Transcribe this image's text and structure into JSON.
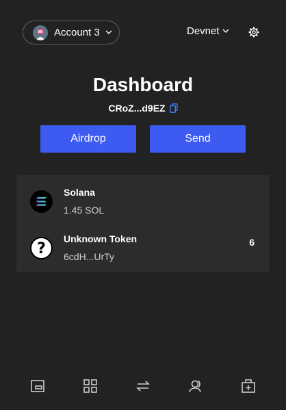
{
  "header": {
    "account_label": "Account 3",
    "network_label": "Devnet",
    "icons": [
      "avatar",
      "chevron-down-icon",
      "gear-icon"
    ]
  },
  "dashboard": {
    "title": "Dashboard",
    "address": "CRoZ...d9EZ",
    "copy_icon": "copy-icon"
  },
  "actions": {
    "airdrop_label": "Airdrop",
    "send_label": "Send",
    "color": "#3d5af1"
  },
  "tokens": [
    {
      "name": "Solana",
      "subtitle": "1.45 SOL",
      "amount": "",
      "icon": "solana-logo-icon"
    },
    {
      "name": "Unknown Token",
      "subtitle": "6cdH...UrTy",
      "amount": "6",
      "icon": "question-mark-icon"
    }
  ],
  "nav": {
    "icons": [
      "wallet-icon",
      "grid-icon",
      "swap-icon",
      "contacts-icon",
      "add-box-icon"
    ]
  }
}
